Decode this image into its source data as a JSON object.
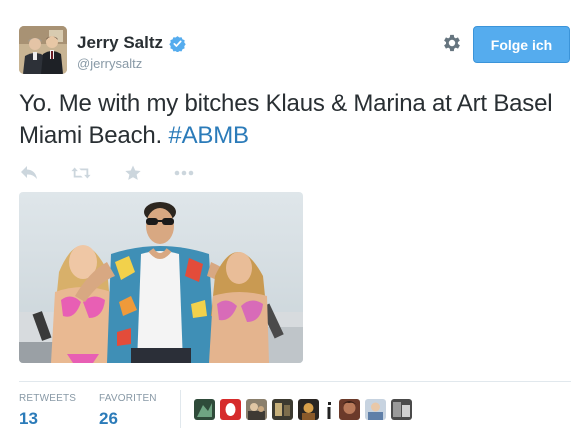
{
  "author": {
    "display_name": "Jerry Saltz",
    "handle": "@jerrysaltz",
    "verified": true
  },
  "header": {
    "follow_label": "Folge ich",
    "settings_icon": "gear-icon"
  },
  "tweet": {
    "text": "Yo. Me with my bitches Klaus & Marina at Art Basel Miami Beach. ",
    "hashtag": "#ABMB"
  },
  "actions": [
    "reply-icon",
    "retweet-icon",
    "favorite-icon",
    "more-icon"
  ],
  "stats": {
    "retweets_label": "RETWEETS",
    "retweets_count": "13",
    "favorites_label": "FAVORITEN",
    "favorites_count": "26"
  },
  "colors": {
    "link": "#2b7bb9",
    "follow_button": "#55acee",
    "muted": "#8899a6",
    "text": "#292f33"
  }
}
